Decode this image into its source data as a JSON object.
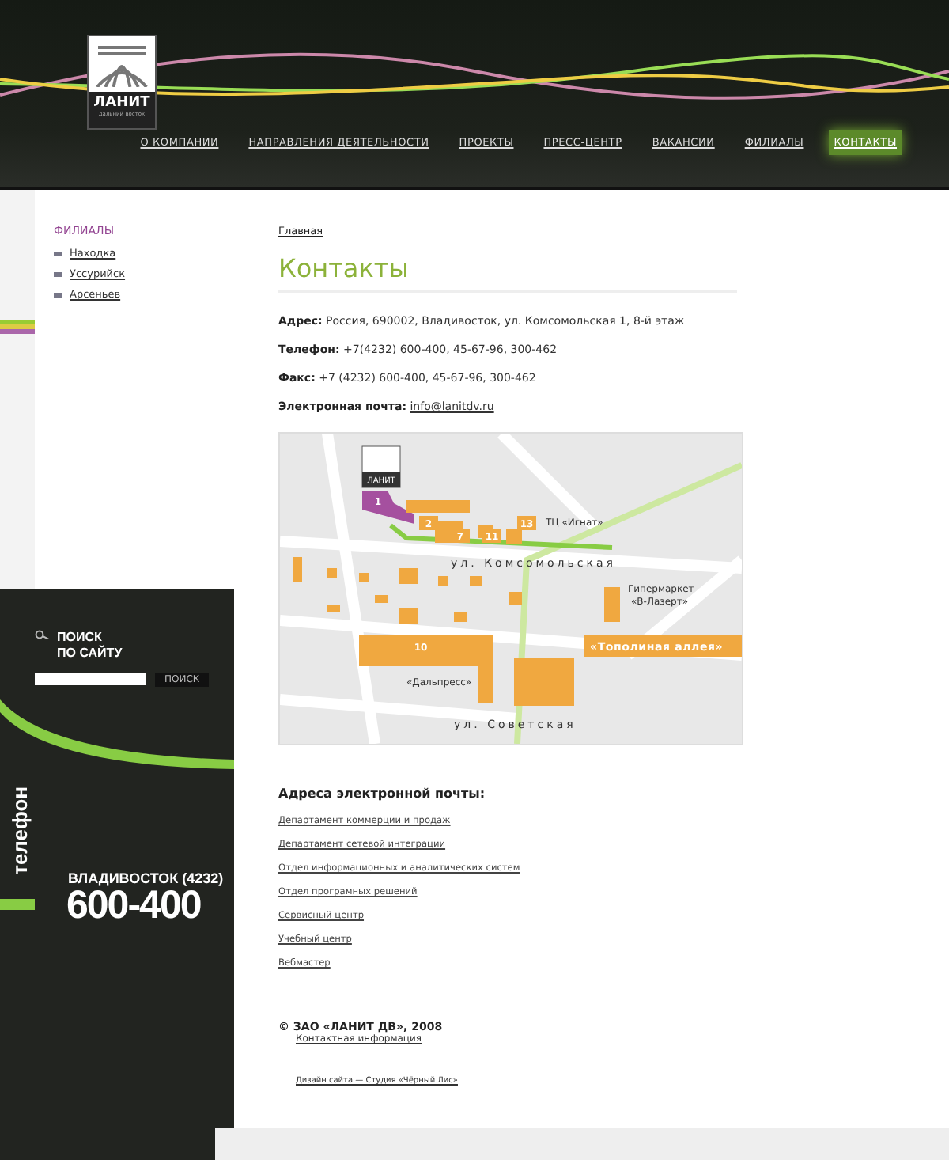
{
  "header": {
    "logo": {
      "name": "ЛАНИТ",
      "subtitle": "дальний восток"
    },
    "nav": [
      {
        "label": "О КОМПАНИИ",
        "selected": false
      },
      {
        "label": "НАПРАВЛЕНИЯ ДЕЯТЕЛЬНОСТИ",
        "selected": false
      },
      {
        "label": "ПРОЕКТЫ",
        "selected": false
      },
      {
        "label": "ПРЕСС-ЦЕНТР",
        "selected": false
      },
      {
        "label": "ВАКАНСИИ",
        "selected": false
      },
      {
        "label": "ФИЛИАЛЫ",
        "selected": false
      },
      {
        "label": "КОНТАКТЫ",
        "selected": true
      }
    ]
  },
  "sidebar": {
    "title": "ФИЛИАЛЫ",
    "items": [
      "Находка",
      "Уссурийск",
      "Арсеньев"
    ],
    "search": {
      "title_lines": [
        "ПОИСК",
        "ПО САЙТУ"
      ],
      "button": "ПОИСК"
    },
    "phone": {
      "vertical_label": "телефон",
      "city": "ВЛАДИВОСТОК  (4232)",
      "number": "600-400"
    }
  },
  "breadcrumb": "Главная",
  "title": "Контакты",
  "details": [
    {
      "label": "Адрес:",
      "value": "Россия, 690002, Владивосток, ул. Комсомольская 1, 8-й этаж",
      "kind": "text"
    },
    {
      "label": "Телефон:",
      "value": "+7(4232) 600-400, 45-67-96, 300-462",
      "kind": "text"
    },
    {
      "label": "Факс:",
      "value": "+7 (4232) 600-400, 45-67-96, 300-462",
      "kind": "text"
    },
    {
      "label": "Электронная почта:",
      "value": "info@lanitdv.ru",
      "kind": "link"
    }
  ],
  "map": {
    "logo": "ЛАНИТ",
    "streets": [
      "ул. Комсомольская",
      "ул. Советская",
      "«Тополиная аллея»"
    ],
    "places": [
      "ТЦ «Игнат»",
      "Гипермаркет",
      "«В-Лазерт»",
      "«Дальпресс»"
    ],
    "buildings": [
      "1",
      "2",
      "7",
      "11",
      "13",
      "10"
    ]
  },
  "emails": {
    "title": "Адреса электронной почты:",
    "links": [
      "Департамент коммерции и продаж",
      "Департамент сетевой интеграции",
      "Отдел информационных и аналитических систем",
      "Отдел програмных решений",
      "Сервисный центр",
      "Учебный центр",
      "Вебмастер"
    ]
  },
  "footer": {
    "copyright": "©  ЗАО «ЛАНИТ ДВ», 2008",
    "contact_link": "Контактная информация",
    "design": "Дизайн сайта — Студия «Чёрный Лис»"
  }
}
